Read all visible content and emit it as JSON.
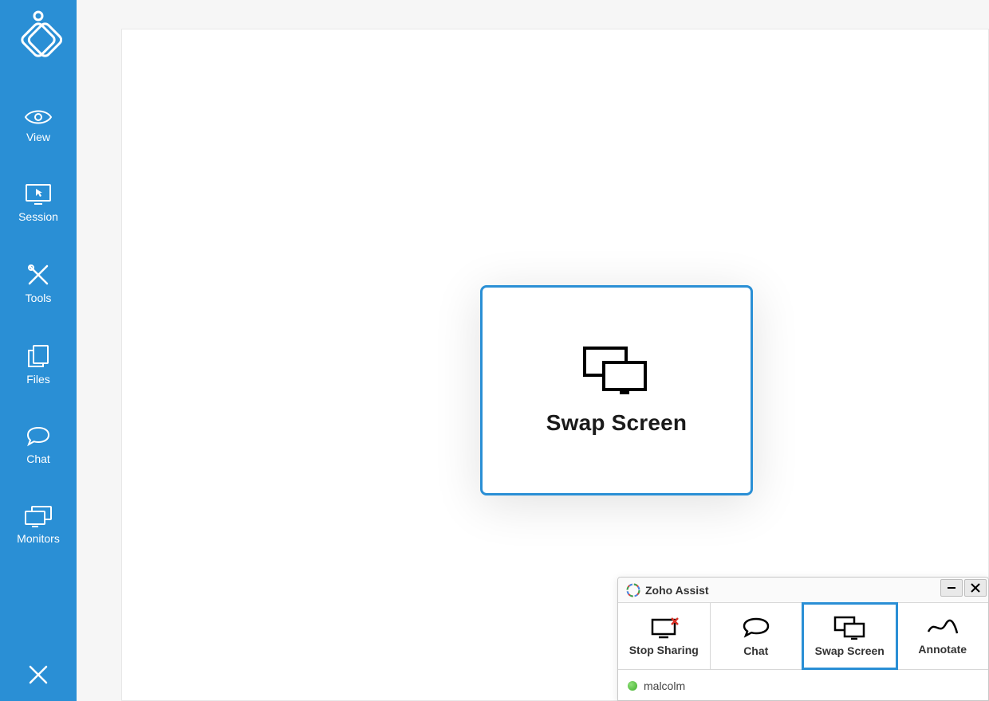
{
  "sidebar": {
    "items": [
      {
        "label": "View"
      },
      {
        "label": "Session"
      },
      {
        "label": "Tools"
      },
      {
        "label": "Files"
      },
      {
        "label": "Chat"
      },
      {
        "label": "Monitors"
      }
    ]
  },
  "center_card": {
    "title": "Swap Screen"
  },
  "panel": {
    "title": "Zoho Assist",
    "tabs": [
      {
        "label": "Stop Sharing"
      },
      {
        "label": "Chat"
      },
      {
        "label": "Swap Screen"
      },
      {
        "label": "Annotate"
      }
    ],
    "active_tab_index": 2,
    "user": {
      "name": "malcolm",
      "status": "online"
    }
  },
  "colors": {
    "accent": "#2a8fd5"
  }
}
